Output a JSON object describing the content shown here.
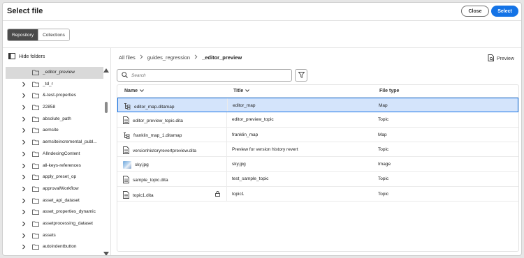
{
  "header": {
    "title": "Select file",
    "close_label": "Close",
    "select_label": "Select"
  },
  "toggle": {
    "repository": "Repository",
    "collections": "Collections"
  },
  "sidebar": {
    "hide_folders_label": "Hide folders",
    "folders": [
      {
        "label": "_editor_preview",
        "selected": true,
        "chevron": false
      },
      {
        "label": "_td_r",
        "chevron": true
      },
      {
        "label": "&-test-properties",
        "chevron": true
      },
      {
        "label": "22858",
        "chevron": true
      },
      {
        "label": "absolute_path",
        "chevron": true
      },
      {
        "label": "aemsite",
        "chevron": true
      },
      {
        "label": "aemsiteincremental_publ...",
        "chevron": true
      },
      {
        "label": "AIIndexingContent",
        "chevron": true
      },
      {
        "label": "all-keys-references",
        "chevron": true
      },
      {
        "label": "apply_preset_op",
        "chevron": true
      },
      {
        "label": "approvalWorkflow",
        "chevron": true
      },
      {
        "label": "asset_api_dataset",
        "chevron": true
      },
      {
        "label": "asset_properties_dynamic",
        "chevron": true
      },
      {
        "label": "assetprocessing_dataset",
        "chevron": true
      },
      {
        "label": "assets",
        "chevron": true
      },
      {
        "label": "autoindentbutton",
        "chevron": true
      }
    ]
  },
  "breadcrumb": {
    "items": [
      "All files",
      "guides_regression",
      "_editor_preview"
    ]
  },
  "preview_label": "Preview",
  "search": {
    "placeholder": "Search"
  },
  "table": {
    "columns": [
      "Name",
      "Title",
      "File type"
    ],
    "rows": [
      {
        "name": "editor_map.ditamap",
        "title": "editor_map",
        "type": "Map",
        "icon": "map-icon",
        "selected": true
      },
      {
        "name": "editor_preview_topic.dita",
        "title": "editor_preview_topic",
        "type": "Topic",
        "icon": "document-icon"
      },
      {
        "name": "franklin_map_1.ditamap",
        "title": "franklin_map",
        "type": "Map",
        "icon": "map-icon"
      },
      {
        "name": "versionhistoryrevertpreview.dita",
        "title": "Preview for version history revert",
        "type": "Topic",
        "icon": "document-icon"
      },
      {
        "name": "sky.jpg",
        "title": "sky.jpg",
        "type": "Image",
        "icon": "image-thumbnail"
      },
      {
        "name": "sample_topic.dita",
        "title": "test_sample_topic",
        "type": "Topic",
        "icon": "document-icon"
      },
      {
        "name": "topic1.dita",
        "title": "topic1",
        "type": "Topic",
        "icon": "document-icon",
        "locked": true
      }
    ]
  },
  "colors": {
    "accent": "#1473e6",
    "selected_row": "#d4e4fb",
    "selected_folder": "#d9d9d9"
  }
}
